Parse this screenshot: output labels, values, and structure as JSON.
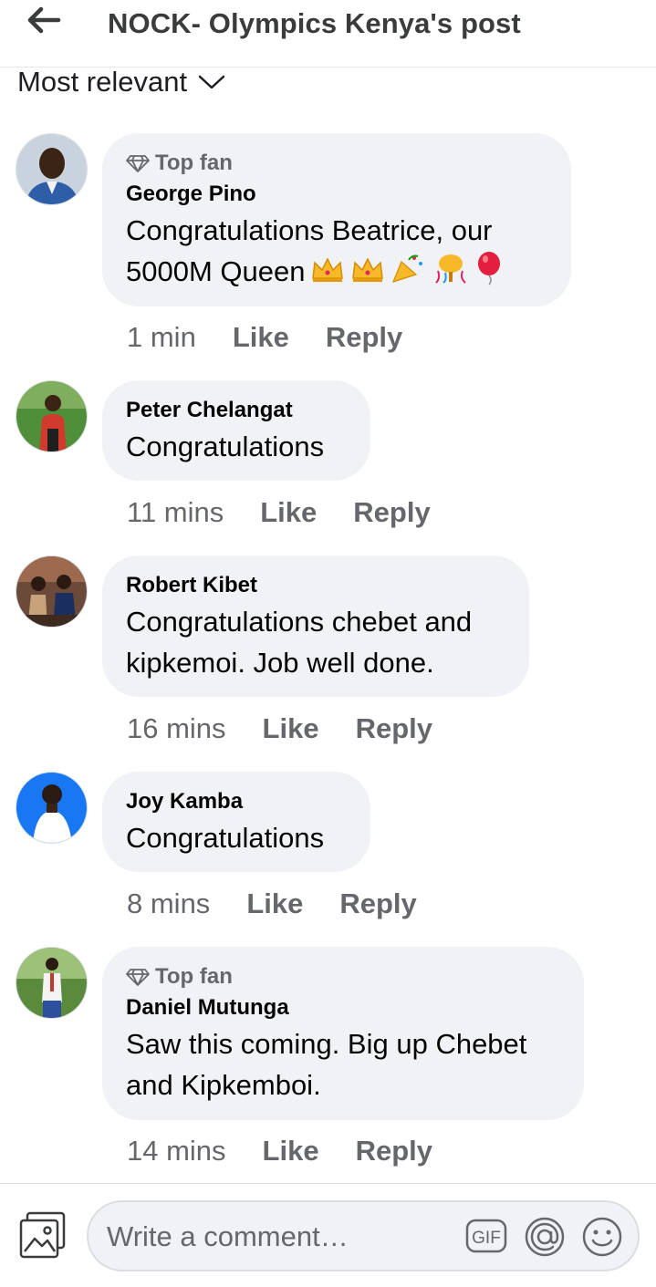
{
  "header": {
    "title": "NOCK- Olympics Kenya's post",
    "back_icon": "arrow-left-icon"
  },
  "sort": {
    "label": "Most relevant",
    "icon": "chevron-down-icon"
  },
  "comments": [
    {
      "badge": "Top fan",
      "author": "George Pino",
      "lines": [
        "Congratulations Beatrice, our",
        "5000M Queen"
      ],
      "emojis": [
        "crown",
        "crown",
        "party-popper",
        "confetti",
        "balloon"
      ],
      "time": "1 min",
      "like": "Like",
      "reply": "Reply"
    },
    {
      "badge": "",
      "author": "Peter Chelangat",
      "lines": [
        "Congratulations"
      ],
      "time": "11 mins",
      "like": "Like",
      "reply": "Reply"
    },
    {
      "badge": "",
      "author": "Robert Kibet",
      "lines": [
        "Congratulations chebet and",
        "kipkemoi. Job well done."
      ],
      "time": "16 mins",
      "like": "Like",
      "reply": "Reply"
    },
    {
      "badge": "",
      "author": "Joy Kamba",
      "lines": [
        "Congratulations"
      ],
      "time": "8 mins",
      "like": "Like",
      "reply": "Reply"
    },
    {
      "badge": "Top fan",
      "author": "Daniel Mutunga",
      "lines": [
        "Saw this coming. Big up Chebet",
        "and Kipkemboi."
      ],
      "time": "14 mins",
      "like": "Like",
      "reply": "Reply"
    }
  ],
  "composer": {
    "placeholder": "Write a comment…",
    "gif_label": "GIF",
    "icons": [
      "photo-icon",
      "gif-icon",
      "mention-icon",
      "emoji-icon"
    ]
  },
  "colors": {
    "bubble": "#f0f2f5",
    "secondary_text": "#65676b",
    "primary_text": "#050505"
  }
}
